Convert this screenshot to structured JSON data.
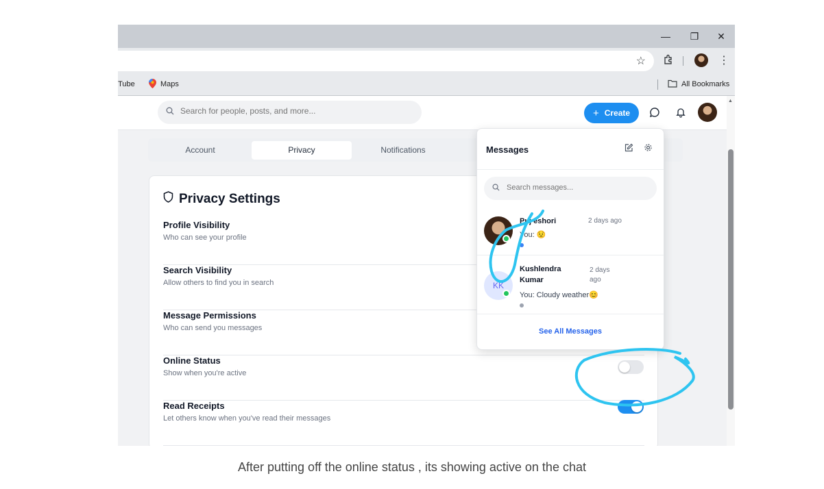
{
  "window_controls": {
    "minimize": "—",
    "restore": "❐",
    "close": "✕"
  },
  "bookmarks": [
    {
      "label": "uTube"
    },
    {
      "label": "Maps"
    }
  ],
  "all_bookmarks": "All Bookmarks",
  "app": {
    "search_placeholder": "Search for people, posts, and more...",
    "create_label": "Create",
    "create_icon": "plus-icon",
    "accent_color": "#1d8ef0"
  },
  "tabs": [
    {
      "label": "Account",
      "active": false
    },
    {
      "label": "Privacy",
      "active": true
    },
    {
      "label": "Notifications",
      "active": false
    }
  ],
  "privacy": {
    "title": "Privacy Settings",
    "title_icon": "shield-icon",
    "rows": [
      {
        "label": "Profile Visibility",
        "desc": "Who can see your profile"
      },
      {
        "label": "Search Visibility",
        "desc": "Allow others to find you in search"
      },
      {
        "label": "Message Permissions",
        "desc": "Who can send you messages"
      },
      {
        "label": "Online Status",
        "desc": "Show when you're active",
        "toggle": false
      },
      {
        "label": "Read Receipts",
        "desc": "Let others know when you've read their messages",
        "toggle": true
      }
    ]
  },
  "messages": {
    "title": "Messages",
    "search_placeholder": "Search messages...",
    "conversations": [
      {
        "name": "Puj eshori",
        "time": "2 days ago",
        "preview": "You:",
        "emoji": "😟",
        "online": true,
        "unread_color": "#3b82f6"
      },
      {
        "name_line1": "Kushlendra",
        "name_line2": "Kumar",
        "initials": "KK",
        "time_line1": "2 days",
        "time_line2": "ago",
        "preview": "You: Cloudy weather",
        "emoji": "😊",
        "online": true,
        "unread_color": "#9ca3af"
      }
    ],
    "see_all": "See All Messages"
  },
  "caption": "After putting off the online status , its showing active on the chat",
  "annotation_color": "#2ec4f0"
}
